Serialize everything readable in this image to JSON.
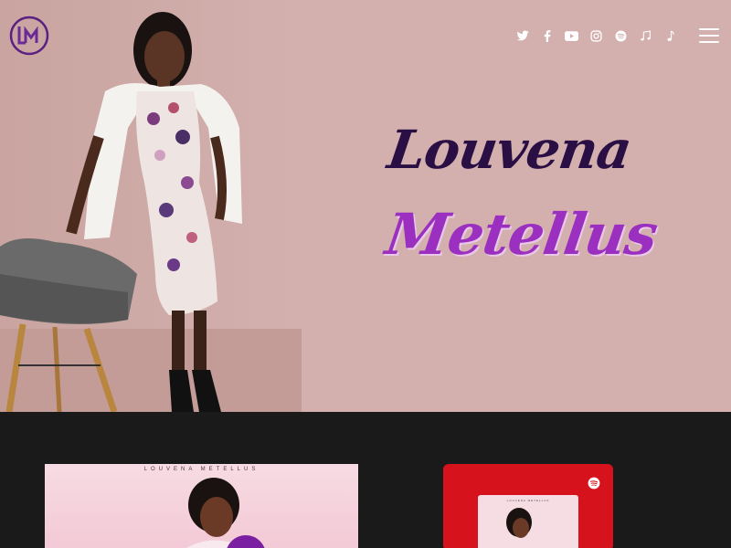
{
  "brand": {
    "logo_text": "LM",
    "logo_icon": "lm-monogram-logo"
  },
  "social": [
    {
      "name": "twitter",
      "icon": "twitter-icon"
    },
    {
      "name": "facebook",
      "icon": "facebook-icon"
    },
    {
      "name": "youtube",
      "icon": "youtube-icon"
    },
    {
      "name": "instagram",
      "icon": "instagram-icon"
    },
    {
      "name": "spotify",
      "icon": "spotify-icon"
    },
    {
      "name": "apple-music",
      "icon": "music-note-icon"
    },
    {
      "name": "tiktok",
      "icon": "music-note-single-icon"
    }
  ],
  "hero": {
    "first_name": "Louvena",
    "last_name": "Metellus"
  },
  "album": {
    "artist_caption": "LOUVENA METELLUS"
  },
  "spotify_card": {
    "cover_caption": "LOUVENA METELLUS"
  },
  "colors": {
    "hero_bg": "#d3b0ae",
    "dark_bg": "#1a1a1a",
    "title_dark": "#2a0f44",
    "title_purple": "#9b2fc0",
    "spotify_red": "#d6131d",
    "play_purple": "#7b1fa2"
  }
}
